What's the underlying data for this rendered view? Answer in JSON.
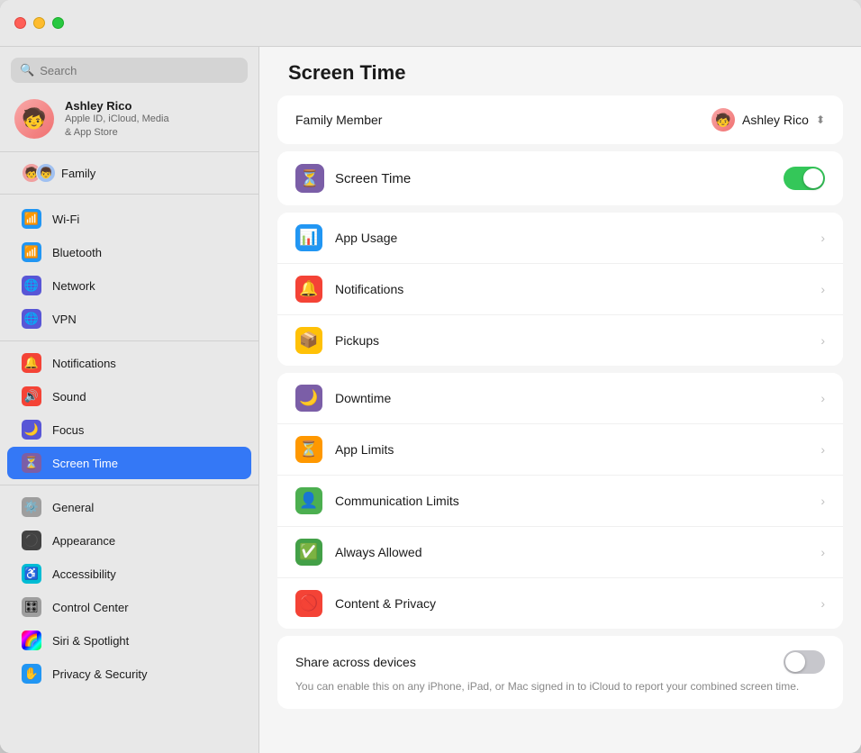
{
  "window": {
    "title": "Screen Time"
  },
  "search": {
    "placeholder": "Search"
  },
  "user": {
    "name": "Ashley Rico",
    "sub1": "Apple ID, iCloud, Media",
    "sub2": "& App Store",
    "emoji": "🧒"
  },
  "family": {
    "label": "Family"
  },
  "sidebar": {
    "items": [
      {
        "id": "wifi",
        "label": "Wi-Fi",
        "icon": "📶",
        "color": "icon-wifi"
      },
      {
        "id": "bluetooth",
        "label": "Bluetooth",
        "icon": "🔷",
        "color": "icon-bt"
      },
      {
        "id": "network",
        "label": "Network",
        "icon": "🌐",
        "color": "icon-indigo"
      },
      {
        "id": "vpn",
        "label": "VPN",
        "icon": "🌐",
        "color": "icon-indigo"
      },
      {
        "id": "notifications",
        "label": "Notifications",
        "icon": "🔔",
        "color": "icon-red"
      },
      {
        "id": "sound",
        "label": "Sound",
        "icon": "🔊",
        "color": "icon-red"
      },
      {
        "id": "focus",
        "label": "Focus",
        "icon": "🌙",
        "color": "icon-indigo"
      },
      {
        "id": "screen-time",
        "label": "Screen Time",
        "icon": "⏳",
        "color": "icon-purple2",
        "active": true
      },
      {
        "id": "general",
        "label": "General",
        "icon": "⚙️",
        "color": "icon-gray"
      },
      {
        "id": "appearance",
        "label": "Appearance",
        "icon": "⚫",
        "color": "icon-dark"
      },
      {
        "id": "accessibility",
        "label": "Accessibility",
        "icon": "♿",
        "color": "icon-cyan"
      },
      {
        "id": "control-center",
        "label": "Control Center",
        "icon": "🎛",
        "color": "icon-gray"
      },
      {
        "id": "siri-spotlight",
        "label": "Siri & Spotlight",
        "icon": "🌈",
        "color": "icon-gray"
      },
      {
        "id": "privacy-security",
        "label": "Privacy & Security",
        "icon": "✋",
        "color": "icon-blue"
      }
    ]
  },
  "main": {
    "title": "Screen Time",
    "family_member_label": "Family Member",
    "member_name": "Ashley Rico",
    "screen_time_label": "Screen Time",
    "toggle_on": true,
    "menu_items": [
      {
        "id": "app-usage",
        "label": "App Usage",
        "icon": "📊",
        "color": "icon-blue"
      },
      {
        "id": "notifications",
        "label": "Notifications",
        "icon": "🔔",
        "color": "icon-red"
      },
      {
        "id": "pickups",
        "label": "Pickups",
        "icon": "📦",
        "color": "icon-amber"
      }
    ],
    "menu_items2": [
      {
        "id": "downtime",
        "label": "Downtime",
        "icon": "🌙",
        "color": "icon-purple"
      },
      {
        "id": "app-limits",
        "label": "App Limits",
        "icon": "⏳",
        "color": "icon-amber"
      },
      {
        "id": "communication-limits",
        "label": "Communication Limits",
        "icon": "👤",
        "color": "icon-green"
      },
      {
        "id": "always-allowed",
        "label": "Always Allowed",
        "icon": "✅",
        "color": "icon-green2"
      },
      {
        "id": "content-privacy",
        "label": "Content & Privacy",
        "icon": "🚫",
        "color": "icon-red"
      }
    ],
    "share_title": "Share across devices",
    "share_desc": "You can enable this on any iPhone, iPad, or Mac signed in to iCloud to report your combined screen time."
  }
}
